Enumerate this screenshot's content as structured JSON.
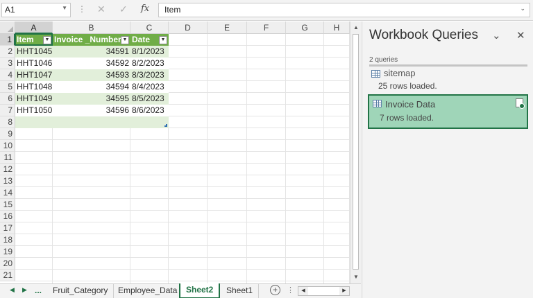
{
  "formula_bar": {
    "name_box": "A1",
    "cancel_icon": "✕",
    "enter_icon": "✓",
    "fx_label": "fx",
    "content": "Item"
  },
  "grid": {
    "columns": [
      "A",
      "B",
      "C",
      "D",
      "E",
      "F",
      "G",
      "H"
    ],
    "rows": [
      "1",
      "2",
      "3",
      "4",
      "5",
      "6",
      "7",
      "8",
      "9",
      "10",
      "11",
      "12",
      "13",
      "14",
      "15",
      "16",
      "17",
      "18",
      "19",
      "20",
      "21"
    ],
    "table": {
      "headers": [
        "Item",
        "Invoice _Number",
        "Date"
      ],
      "rows": [
        [
          "HHT1045",
          "34591",
          "8/1/2023"
        ],
        [
          "HHT1046",
          "34592",
          "8/2/2023"
        ],
        [
          "HHT1047",
          "34593",
          "8/3/2023"
        ],
        [
          "HHT1048",
          "34594",
          "8/4/2023"
        ],
        [
          "HHT1049",
          "34595",
          "8/5/2023"
        ],
        [
          "HHT1050",
          "34596",
          "8/6/2023"
        ]
      ]
    },
    "selected_cell": "A1"
  },
  "sheet_tabs": {
    "more": "...",
    "tabs": [
      "Fruit_Category",
      "Employee_Data",
      "Sheet2",
      "Sheet1"
    ],
    "active": "Sheet2",
    "add_label": "+"
  },
  "queries_pane": {
    "title": "Workbook Queries",
    "count_label": "2 queries",
    "queries": [
      {
        "name": "sitemap",
        "status": "25 rows loaded."
      },
      {
        "name": "Invoice Data",
        "status": "7 rows loaded."
      }
    ]
  },
  "colors": {
    "excel_green": "#217346",
    "table_header": "#70ad47",
    "table_band": "#e2efda",
    "active_query": "#9fd5b8"
  }
}
